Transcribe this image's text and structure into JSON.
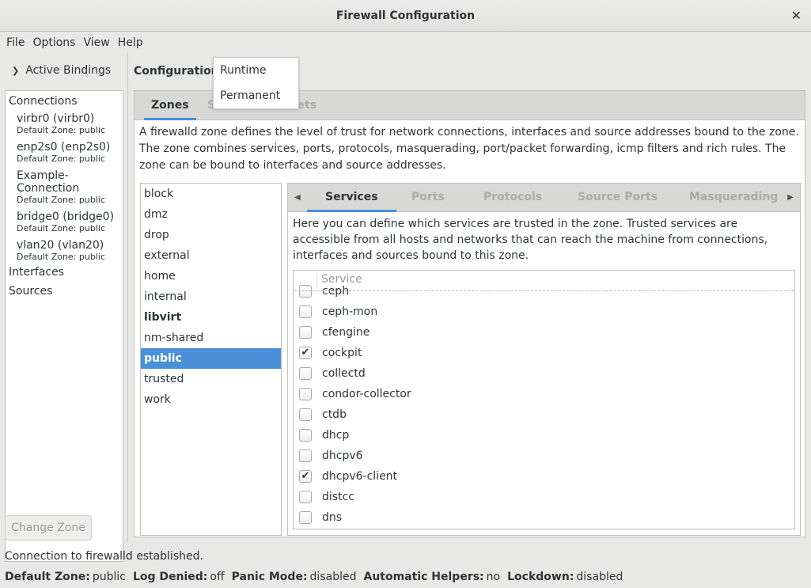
{
  "window": {
    "title": "Firewall Configuration",
    "close": "✕"
  },
  "menu": [
    "File",
    "Options",
    "View",
    "Help"
  ],
  "left": {
    "active_bindings": "Active Bindings",
    "connections_header": "Connections",
    "connections": [
      {
        "name": "virbr0 (virbr0)",
        "zone": "Default Zone: public"
      },
      {
        "name": "enp2s0 (enp2s0)",
        "zone": "Default Zone: public"
      },
      {
        "name": "Example-Connection",
        "zone": "Default Zone: public"
      },
      {
        "name": "bridge0 (bridge0)",
        "zone": "Default Zone: public"
      },
      {
        "name": "vlan20 (vlan20)",
        "zone": "Default Zone: public"
      }
    ],
    "interfaces": "Interfaces",
    "sources": "Sources",
    "change_zone": "Change Zone"
  },
  "config": {
    "label": "Configuration:",
    "options": [
      "Runtime",
      "Permanent"
    ]
  },
  "main_tabs": [
    "Zones",
    "Services",
    "IPSets"
  ],
  "zone_description": "A firewalld zone defines the level of trust for network connections, interfaces and source addresses bound to the zone. The zone combines services, ports, protocols, masquerading, port/packet forwarding, icmp filters and rich rules. The zone can be bound to interfaces and source addresses.",
  "zones": [
    "block",
    "dmz",
    "drop",
    "external",
    "home",
    "internal",
    "libvirt",
    "nm-shared",
    "public",
    "trusted",
    "work"
  ],
  "selected_zone": "public",
  "zone_tabs": [
    "Services",
    "Ports",
    "Protocols",
    "Source Ports",
    "Masquerading"
  ],
  "services_description": "Here you can define which services are trusted in the zone. Trusted services are accessible from all hosts and networks that can reach the machine from connections, interfaces and sources bound to this zone.",
  "services_header": "Service",
  "services": [
    {
      "name": "ceph",
      "checked": false
    },
    {
      "name": "ceph-mon",
      "checked": false
    },
    {
      "name": "cfengine",
      "checked": false
    },
    {
      "name": "cockpit",
      "checked": true
    },
    {
      "name": "collectd",
      "checked": false
    },
    {
      "name": "condor-collector",
      "checked": false
    },
    {
      "name": "ctdb",
      "checked": false
    },
    {
      "name": "dhcp",
      "checked": false
    },
    {
      "name": "dhcpv6",
      "checked": false
    },
    {
      "name": "dhcpv6-client",
      "checked": true
    },
    {
      "name": "distcc",
      "checked": false
    },
    {
      "name": "dns",
      "checked": false
    }
  ],
  "status": "Connection to firewalld established.",
  "info": [
    {
      "label": "Default Zone:",
      "value": "public"
    },
    {
      "label": "Log Denied:",
      "value": "off"
    },
    {
      "label": "Panic Mode:",
      "value": "disabled"
    },
    {
      "label": "Automatic Helpers:",
      "value": "no"
    },
    {
      "label": "Lockdown:",
      "value": "disabled"
    }
  ],
  "accent": "#4a90d9"
}
